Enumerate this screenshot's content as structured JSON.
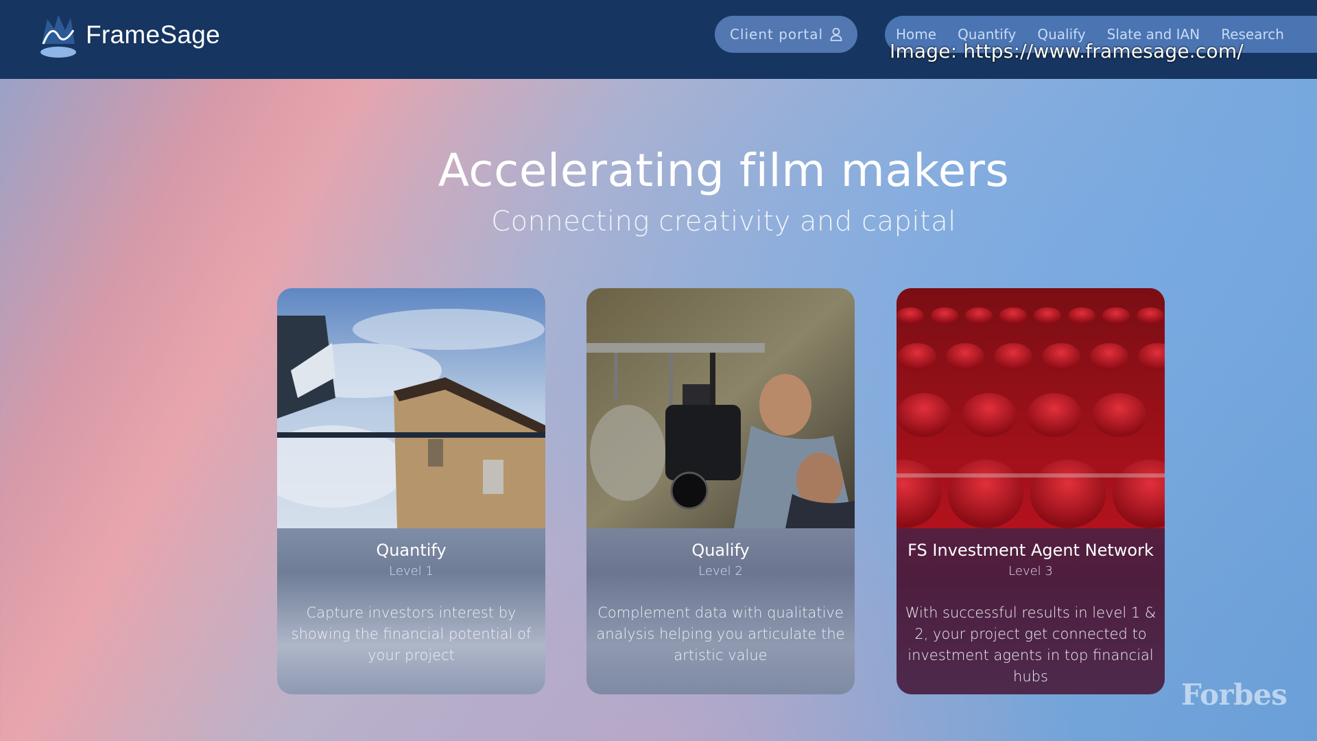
{
  "header": {
    "brand": "FrameSage",
    "client_portal_label": "Client portal",
    "client_portal_icon": "user-icon",
    "nav": [
      "Home",
      "Quantify",
      "Qualify",
      "Slate and IAN",
      "Research"
    ],
    "background_color": "#163560"
  },
  "caption": "Image: https://www.framesage.com/",
  "hero": {
    "title": "Accelerating film makers",
    "subtitle": "Connecting creativity and capital"
  },
  "cards": [
    {
      "title": "Quantify",
      "level": "Level 1",
      "description": "Capture investors interest by showing the financial potential of your project",
      "image": "film-crane-photo"
    },
    {
      "title": "Qualify",
      "level": "Level 2",
      "description": "Complement data with qualitative analysis helping you articulate the artistic value",
      "image": "camera-operator-photo"
    },
    {
      "title": "FS Investment Agent Network",
      "level": "Level 3",
      "description": "With successful results in level 1 & 2, your project get connected to investment agents in top financial hubs",
      "image": "cinema-seats-photo"
    }
  ],
  "watermark": "Forbes"
}
